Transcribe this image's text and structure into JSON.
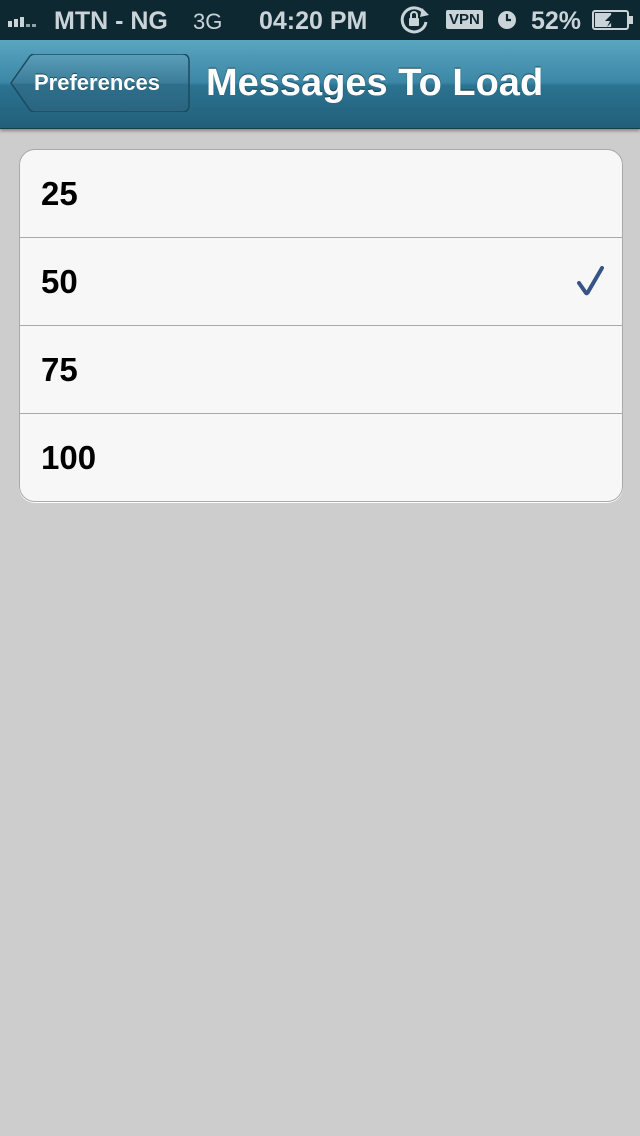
{
  "status_bar": {
    "carrier": "MTN - NG",
    "network": "3G",
    "time": "04:20 PM",
    "vpn": "VPN",
    "battery": "52%",
    "battery_level": 0.52
  },
  "nav": {
    "back_label": "Preferences",
    "title": "Messages To Load"
  },
  "options": [
    {
      "label": "25",
      "selected": false
    },
    {
      "label": "50",
      "selected": true
    },
    {
      "label": "75",
      "selected": false
    },
    {
      "label": "100",
      "selected": false
    }
  ],
  "colors": {
    "nav_accent": "#3b87a5",
    "checkmark": "#385487",
    "background": "#cdcdcd"
  }
}
